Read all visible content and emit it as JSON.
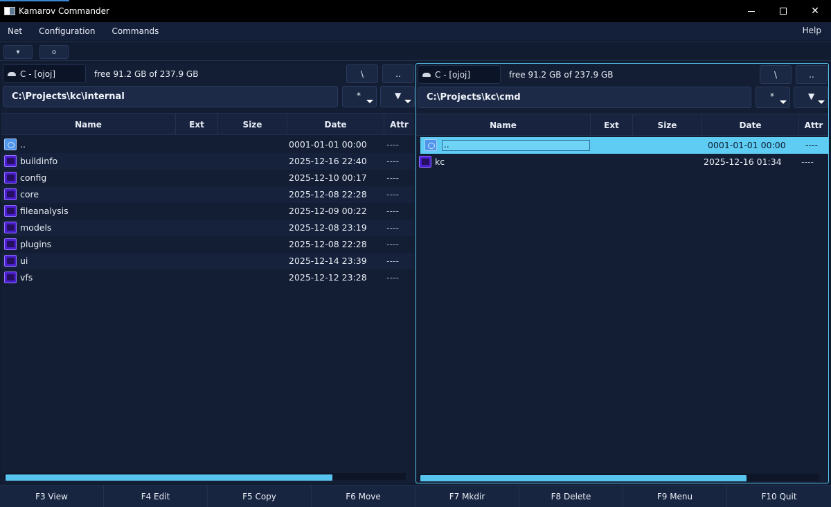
{
  "window": {
    "title": "Kamarov Commander"
  },
  "menu": {
    "items": [
      "Net",
      "Configuration",
      "Commands"
    ],
    "help": "Help"
  },
  "toolbar": {
    "btn1_glyph": "▾",
    "btn2_glyph": "o"
  },
  "left_panel": {
    "drive": "C - [ojoj]",
    "free": "free 91.2 GB of 237.9 GB",
    "root_btn": "\\",
    "up_btn": "..",
    "path": "C:\\Projects\\kc\\internal",
    "filter_btn": "*",
    "sort_btn": "▼",
    "columns": {
      "name": "Name",
      "ext": "Ext",
      "size": "Size",
      "date": "Date",
      "attr": "Attr"
    },
    "rows": [
      {
        "name": "..",
        "date": "0001-01-01 00:00",
        "attr": "----",
        "type": "parent"
      },
      {
        "name": "buildinfo",
        "date": "2025-12-16 22:40",
        "attr": "----",
        "type": "folder"
      },
      {
        "name": "config",
        "date": "2025-12-10 00:17",
        "attr": "----",
        "type": "folder"
      },
      {
        "name": "core",
        "date": "2025-12-08 22:28",
        "attr": "----",
        "type": "folder"
      },
      {
        "name": "fileanalysis",
        "date": "2025-12-09 00:22",
        "attr": "----",
        "type": "folder"
      },
      {
        "name": "models",
        "date": "2025-12-08 23:19",
        "attr": "----",
        "type": "folder"
      },
      {
        "name": "plugins",
        "date": "2025-12-08 22:28",
        "attr": "----",
        "type": "folder"
      },
      {
        "name": "ui",
        "date": "2025-12-14 23:39",
        "attr": "----",
        "type": "folder"
      },
      {
        "name": "vfs",
        "date": "2025-12-12 23:28",
        "attr": "----",
        "type": "folder"
      }
    ],
    "scroll_fraction": 0.82
  },
  "right_panel": {
    "drive": "C - [ojoj]",
    "free": "free 91.2 GB of 237.9 GB",
    "root_btn": "\\",
    "up_btn": "..",
    "path": "C:\\Projects\\kc\\cmd",
    "filter_btn": "*",
    "sort_btn": "▼",
    "columns": {
      "name": "Name",
      "ext": "Ext",
      "size": "Size",
      "date": "Date",
      "attr": "Attr"
    },
    "rows": [
      {
        "name": "..",
        "date": "0001-01-01 00:00",
        "attr": "----",
        "type": "parent",
        "selected": true
      },
      {
        "name": "kc",
        "date": "2025-12-16 01:34",
        "attr": "----",
        "type": "folder"
      }
    ],
    "scroll_fraction": 0.82
  },
  "function_keys": [
    "F3 View",
    "F4 Edit",
    "F5 Copy",
    "F6 Move",
    "F7 Mkdir",
    "F8 Delete",
    "F9 Menu",
    "F10 Quit"
  ],
  "colors": {
    "accent": "#56c4ee",
    "selected_row": "#5fcdf3",
    "folder": "#4b1fd1"
  }
}
